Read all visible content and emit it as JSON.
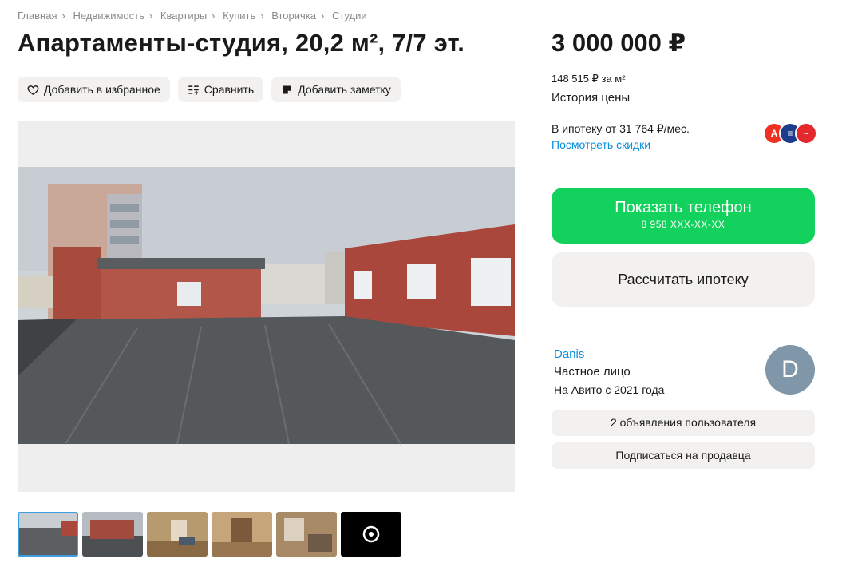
{
  "breadcrumb": [
    "Главная",
    "Недвижимость",
    "Квартиры",
    "Купить",
    "Вторичка",
    "Студии"
  ],
  "title": "Апартаменты-студия, 20,2 м², 7/7 эт.",
  "actions": {
    "favorite": "Добавить в избранное",
    "compare": "Сравнить",
    "note": "Добавить заметку"
  },
  "price": {
    "total": "3 000 000 ₽",
    "per_m2": "148 515 ₽ за м²",
    "history_link": "История цены"
  },
  "mortgage": {
    "text": "В ипотеку от 31 764 ₽/мес.",
    "discounts_link": "Посмотреть скидки",
    "bank_icons": [
      {
        "name": "alfa-bank-icon",
        "glyph": "А",
        "color": "#ef3124"
      },
      {
        "name": "vtb-bank-icon",
        "glyph": "≡",
        "color": "#1e3c8c"
      },
      {
        "name": "sovcom-bank-icon",
        "glyph": "~",
        "color": "#e4282c"
      }
    ]
  },
  "buttons": {
    "show_phone": "Показать телефон",
    "phone_mask": "8 958 XXX-XX-XX",
    "calc_mortgage": "Рассчитать ипотеку",
    "user_ads": "2 объявления пользователя",
    "subscribe": "Подписаться на продавца"
  },
  "seller": {
    "name": "Danis",
    "type": "Частное лицо",
    "since": "На Авито с 2021 года",
    "avatar_letter": "D"
  },
  "colors": {
    "accent_green": "#12d15c",
    "link_blue": "#0a8fdc",
    "button_gray": "#f2f1ef"
  },
  "thumbnails": {
    "count_shown": 6,
    "selected_index": 0,
    "last_is_more_icon": true
  }
}
